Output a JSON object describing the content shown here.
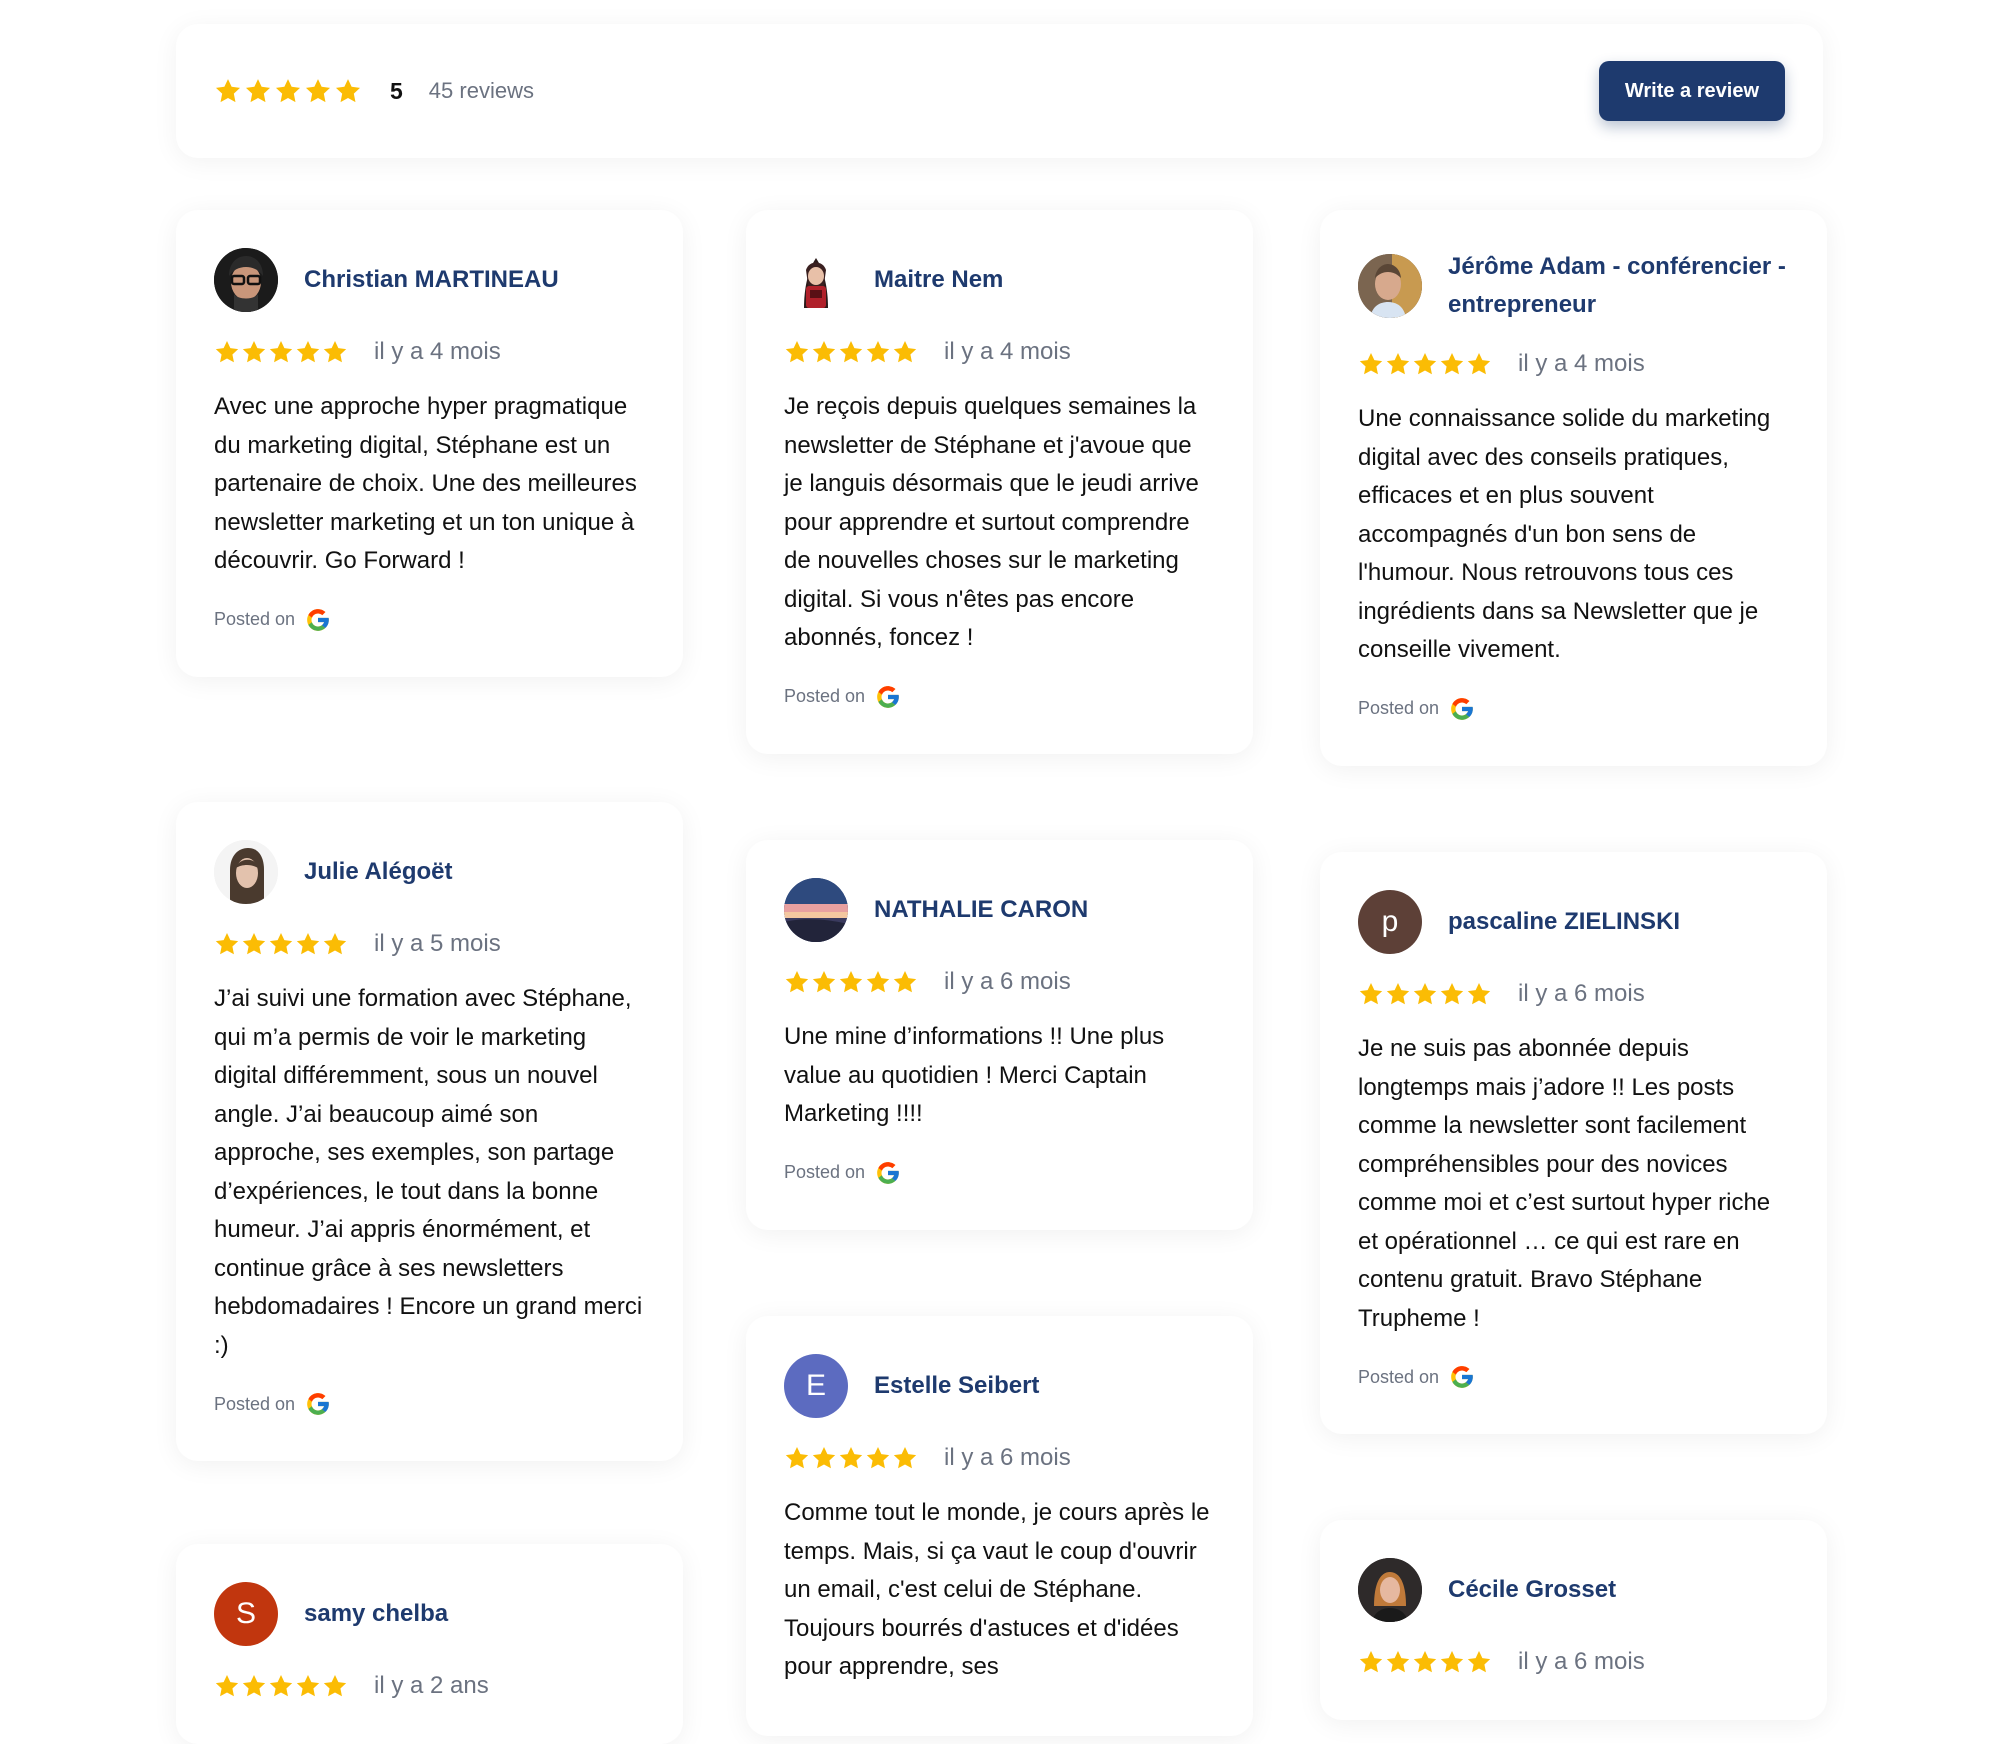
{
  "summary": {
    "score": "5",
    "count_label": "45 reviews",
    "button_label": "Write a review",
    "rating": 5
  },
  "colors": {
    "accent": "#1e3a6e",
    "star": "#fbbc04",
    "muted": "#6b7280"
  },
  "posted_label": "Posted on",
  "reviews": [
    {
      "name": "Christian MARTINEAU",
      "time": "il y a 4 mois",
      "rating": 5,
      "avatar": "photo",
      "text": "Avec une approche hyper pragmatique du marketing digital, Stéphane est un partenaire de choix. Une des meilleures newsletter marketing et un ton unique à découvrir. Go Forward !"
    },
    {
      "name": "Maitre Nem",
      "time": "il y a 4 mois",
      "rating": 5,
      "avatar": "photo",
      "text": "Je reçois depuis quelques semaines la newsletter de Stéphane et j'avoue que je languis désormais que le jeudi arrive pour apprendre et surtout comprendre de nouvelles choses sur le marketing digital. Si vous n'êtes pas encore abonnés, foncez !"
    },
    {
      "name": "Jérôme Adam - conférencier - entrepreneur",
      "time": "il y a 4 mois",
      "rating": 5,
      "avatar": "photo",
      "text": "Une connaissance solide du marketing digital avec des conseils pratiques, efficaces et en plus souvent accompagnés d'un bon sens de l'humour. Nous retrouvons tous ces ingrédients dans sa Newsletter que je conseille vivement."
    },
    {
      "name": "Julie Alégoët",
      "time": "il y a 5 mois",
      "rating": 5,
      "avatar": "photo",
      "text": "J’ai suivi une formation avec Stéphane, qui m’a permis de voir le marketing digital différemment, sous un nouvel angle. J’ai beaucoup aimé son approche, ses exemples, son partage d’expériences, le tout dans la bonne humeur. J’ai appris énormément, et continue grâce à ses newsletters hebdomadaires ! Encore un grand merci :)"
    },
    {
      "name": "NATHALIE CARON",
      "time": "il y a 6 mois",
      "rating": 5,
      "avatar": "photo",
      "text": "Une mine d’informations !! Une plus value au quotidien ! Merci Captain Marketing !!!!"
    },
    {
      "name": "pascaline ZIELINSKI",
      "time": "il y a 6 mois",
      "rating": 5,
      "avatar_letter": "p",
      "avatar_color": "#5d4037",
      "text": "Je ne suis pas abonnée depuis longtemps mais j’adore !! Les posts comme la newsletter sont facilement compréhensibles pour des novices comme moi et c’est surtout hyper riche et opérationnel … ce qui est rare en contenu gratuit. Bravo Stéphane Trupheme !"
    },
    {
      "name": "Estelle Seibert",
      "time": "il y a 6 mois",
      "rating": 5,
      "avatar_letter": "E",
      "avatar_color": "#5c6bc0",
      "text": "Comme tout le monde, je cours après le temps. Mais, si ça vaut le coup d'ouvrir un email, c'est celui de Stéphane. Toujours bourrés d'astuces et d'idées pour apprendre, ses"
    },
    {
      "name": "samy chelba",
      "time": "il y a 2 ans",
      "rating": 5,
      "avatar_letter": "S",
      "avatar_color": "#c1360e"
    },
    {
      "name": "Cécile Grosset",
      "time": "il y a 6 mois",
      "rating": 5,
      "avatar": "photo"
    }
  ]
}
